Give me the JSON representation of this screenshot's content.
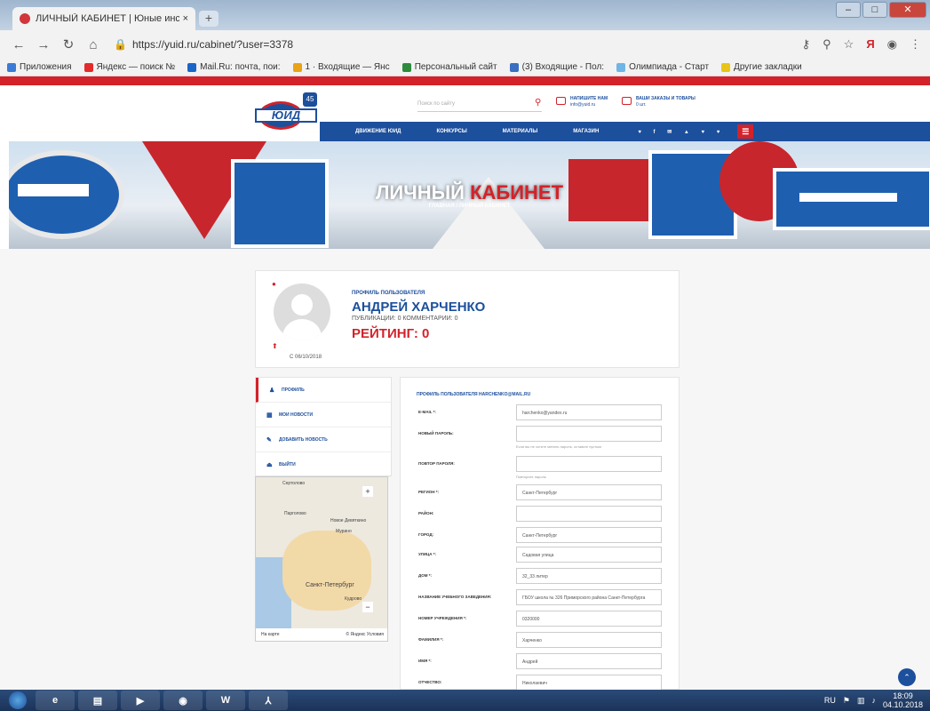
{
  "browser": {
    "tab_title": "ЛИЧНЫЙ КАБИНЕТ | Юные инс",
    "tab_close": "×",
    "new_tab": "+",
    "url": "https://yuid.ru/cabinet/?user=3378",
    "window_buttons": {
      "minimize": "–",
      "maximize": "□",
      "close": "✕"
    }
  },
  "bookmarks": [
    {
      "label": "Приложения",
      "color": "#3a7bd5"
    },
    {
      "label": "Яндекс — поиск №",
      "color": "#e32b2b"
    },
    {
      "label": "Mail.Ru: почта, пои:",
      "color": "#1c64c8"
    },
    {
      "label": "1 · Входящие — Янс",
      "color": "#e8a317"
    },
    {
      "label": "Персональный сайт",
      "color": "#2d8c3c"
    },
    {
      "label": "(3) Входящие - Пол:",
      "color": "#3a6fc2"
    },
    {
      "label": "Олимпиада - Старт",
      "color": "#6fb5e5"
    },
    {
      "label": "Другие закладки",
      "color": "#e8c417"
    }
  ],
  "site": {
    "logo_text": "ЮИД",
    "logo_badge": "45",
    "search_placeholder": "Поиск по сайту",
    "contact1_title": "НАПИШИТЕ НАМ",
    "contact1_sub": "info@yuid.ru",
    "contact2_title": "ВАШИ ЗАКАЗЫ И ТОВАРЫ",
    "contact2_sub": "0 шт.",
    "nav": [
      "ДВИЖЕНИЕ ЮИД",
      "КОНКУРСЫ",
      "МАТЕРИАЛЫ",
      "МАГАЗИН"
    ],
    "social": "♥ f ✉ ▲ ♥ ♥",
    "menu_icon": "☰"
  },
  "hero": {
    "title_white": "ЛИЧНЫЙ",
    "title_red": "КАБИНЕТ",
    "breadcrumb": "ГЛАВНАЯ / ЛИЧНЫЙ КАБИНЕТ"
  },
  "profile": {
    "section_label": "ПРОФИЛЬ ПОЛЬЗОВАТЕЛЯ",
    "name": "АНДРЕЙ ХАРЧЕНКО",
    "stats": "ПУБЛИКАЦИИ: 0 КОММЕНТАРИИ: 0",
    "rating": "РЕЙТИНГ: 0",
    "since": "С 06/10/2018"
  },
  "side_menu": [
    {
      "icon": "♟",
      "label": "ПРОФИЛЬ"
    },
    {
      "icon": "▦",
      "label": "МОИ НОВОСТИ"
    },
    {
      "icon": "✎",
      "label": "ДОБАВИТЬ НОВОСТЬ"
    },
    {
      "icon": "⏏",
      "label": "ВЫЙТИ"
    }
  ],
  "map": {
    "labels": [
      "Сертолово",
      "Парголово",
      "Новое Девяткино",
      "Мурино",
      "Санкт-Петербург",
      "Кудрово"
    ],
    "footer_left": "На карте",
    "footer_right": "© Яндекс Условия"
  },
  "form": {
    "title": "ПРОФИЛЬ ПОЛЬЗОВАТЕЛЯ HARCHENKO@MAIL.RU",
    "rows": [
      {
        "label": "E-MAIL *:",
        "value": "harchenko@yandex.ru",
        "hint": ""
      },
      {
        "label": "НОВЫЙ ПАРОЛЬ:",
        "value": "",
        "hint": "Если вы не хотите менять пароль, оставьте пустым"
      },
      {
        "label": "ПОВТОР ПАРОЛЯ:",
        "value": "",
        "hint": "Повторите пароль"
      },
      {
        "label": "РЕГИОН *:",
        "value": "Санкт-Петербург",
        "hint": ""
      },
      {
        "label": "РАЙОН:",
        "value": "",
        "hint": ""
      },
      {
        "label": "ГОРОД:",
        "value": "Санкт-Петербург",
        "hint": ""
      },
      {
        "label": "УЛИЦА *:",
        "value": "Садовая улица",
        "hint": ""
      },
      {
        "label": "ДОМ *:",
        "value": "32_33 литер",
        "hint": ""
      },
      {
        "label": "НАЗВАНИЕ УЧЕБНОГО ЗАВЕДЕНИЯ:",
        "value": "ГБОУ школа № 326 Приморского района Санкт-Петербурга",
        "hint": ""
      },
      {
        "label": "НОМЕР УЧРЕЖДЕНИЯ *:",
        "value": "0320000",
        "hint": ""
      },
      {
        "label": "ФАМИЛИЯ *:",
        "value": "Харченко",
        "hint": ""
      },
      {
        "label": "ИМЯ *:",
        "value": "Андрей",
        "hint": ""
      },
      {
        "label": "ОТЧЕСТВО:",
        "value": "Николаевич",
        "hint": ""
      }
    ]
  },
  "taskbar": {
    "apps": [
      "e",
      "▤",
      "▶",
      "◉",
      "W",
      "⅄"
    ],
    "lang": "RU",
    "time": "18:09",
    "date": "04.10.2018"
  }
}
